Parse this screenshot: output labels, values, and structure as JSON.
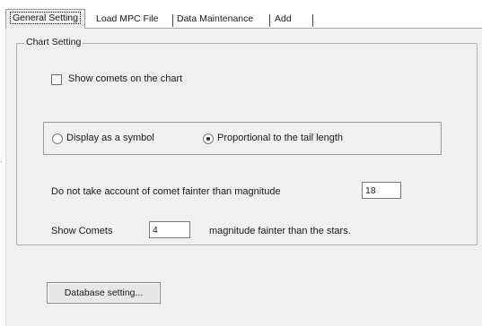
{
  "tabs": [
    {
      "label": "General Setting",
      "active": true
    },
    {
      "label": "Load MPC File",
      "active": false
    },
    {
      "label": "Data Maintenance",
      "active": false
    },
    {
      "label": "Add",
      "active": false
    }
  ],
  "chart_setting": {
    "title": "Chart Setting",
    "show_comets": {
      "label": "Show comets on the chart",
      "checked": false
    },
    "display_mode": {
      "options": [
        {
          "label": "Display as a symbol",
          "selected": false
        },
        {
          "label": "Proportional to the tail length",
          "selected": true
        }
      ]
    },
    "faint_limit": {
      "label": "Do not take account of comet fainter than magnitude",
      "value": "18"
    },
    "show_comets_offset": {
      "label_before": "Show Comets",
      "value": "4",
      "label_after": "magnitude fainter than the stars."
    }
  },
  "database_button": {
    "label": "Database setting..."
  },
  "colors": {
    "panel_bg": "#f0f0f0",
    "border": "#a9a9a9"
  }
}
